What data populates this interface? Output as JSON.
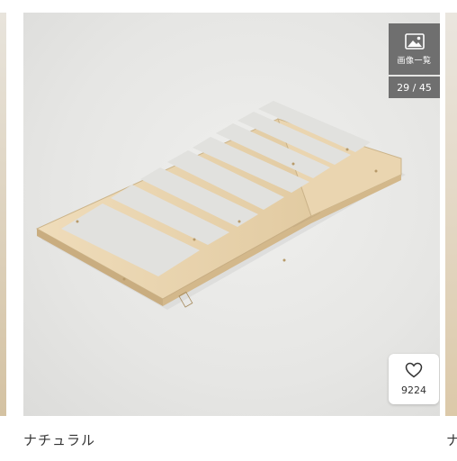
{
  "gallery": {
    "label": "画像一覧",
    "counter": "29 / 45",
    "icon": "image-icon"
  },
  "favorite": {
    "count": "9224",
    "icon": "heart-outline-icon"
  },
  "slide": {
    "caption": "ナチュラル",
    "next_caption": "ナ",
    "photo_description_icon": "wooden-slatted-bed-base-photo"
  },
  "colors": {
    "badge_bg": "#5f5f5f",
    "wood": "#e4cfa9",
    "background": "#e6e6e4"
  }
}
